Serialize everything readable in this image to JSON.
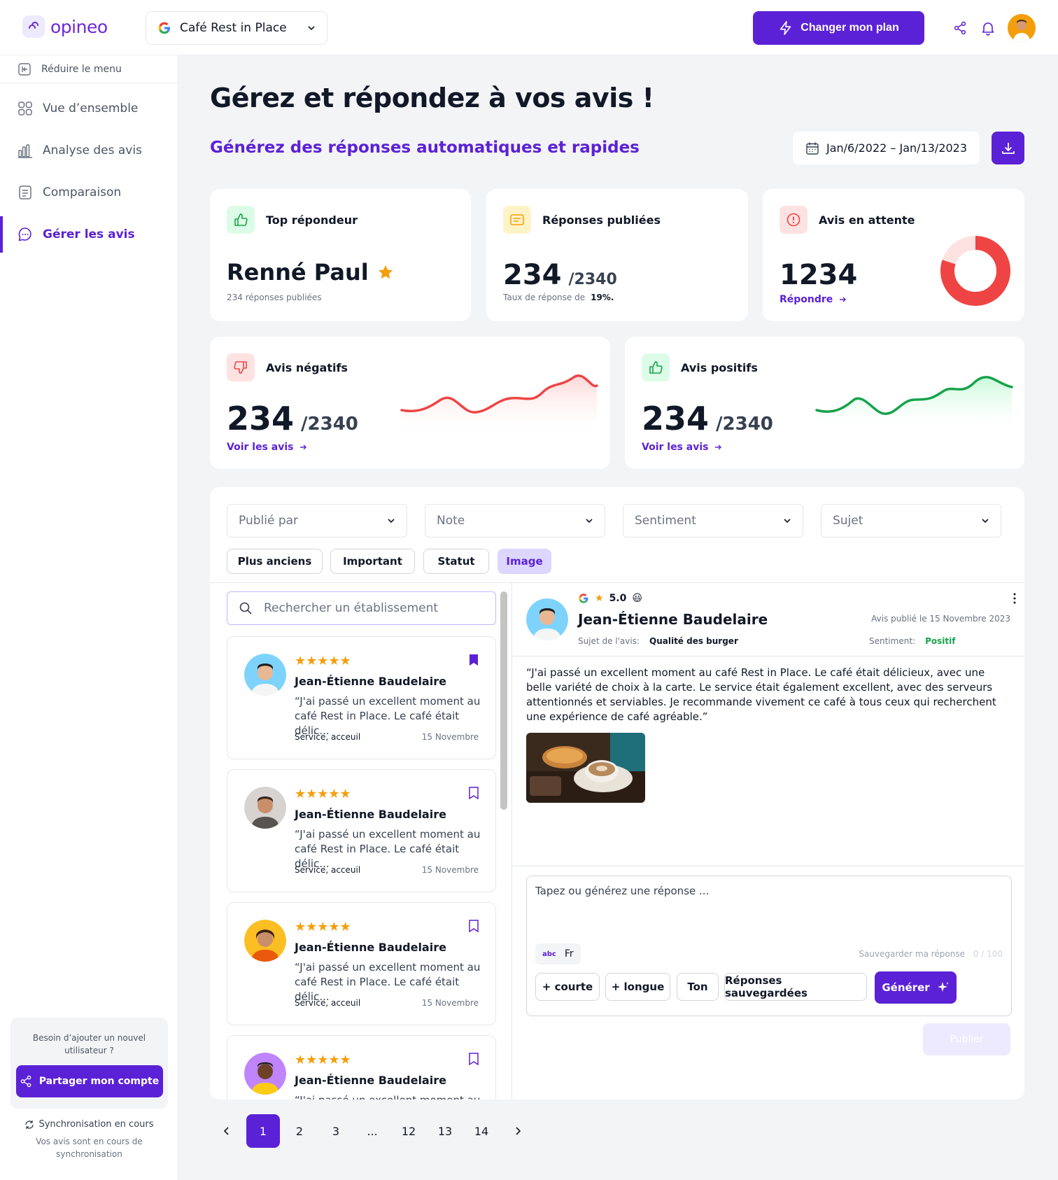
{
  "brand": {
    "name": "opineo",
    "accent": "#5b21d6"
  },
  "header": {
    "location": "Café Rest in Place",
    "plan_button": "Changer mon plan"
  },
  "sidebar": {
    "collapse": "Réduire le menu",
    "items": [
      {
        "label": "Vue d’ensemble",
        "icon": "grid-icon"
      },
      {
        "label": "Analyse des avis",
        "icon": "bar-chart-icon"
      },
      {
        "label": "Comparaison",
        "icon": "document-icon"
      },
      {
        "label": "Gérer les avis",
        "icon": "chat-icon",
        "active": true
      }
    ],
    "help": {
      "text": "Besoin d’ajouter un nouvel utilisateur ?",
      "button": "Partager mon compte"
    },
    "sync": {
      "title": "Synchronisation en cours",
      "subtitle": "Vos avis sont en cours de synchronisation"
    }
  },
  "page": {
    "title": "Gérez et répondez à vos avis !",
    "subtitle": "Générez des réponses automatiques et rapides",
    "date_range": "Jan/6/2022 – Jan/13/2023"
  },
  "stats": {
    "top": {
      "title": "Top répondeur",
      "name": "Renné Paul",
      "sub": "234 réponses publiées"
    },
    "published": {
      "title": "Réponses publiées",
      "value": "234",
      "total": "/2340",
      "rate_label": "Taux de réponse de",
      "rate": "19%."
    },
    "pending": {
      "title": "Avis en attente",
      "value": "1234",
      "link": "Répondre",
      "donut_fraction": 0.8
    },
    "negative": {
      "title": "Avis négatifs",
      "value": "234",
      "total": "/2340",
      "link": "Voir les avis",
      "color": "#ef4444"
    },
    "positive": {
      "title": "Avis positifs",
      "value": "234",
      "total": "/2340",
      "link": "Voir les avis",
      "color": "#16a34a"
    }
  },
  "filters": {
    "selects": [
      "Publié par",
      "Note",
      "Sentiment",
      "Sujet"
    ],
    "chips": [
      "Plus anciens",
      "Important",
      "Statut",
      "Image"
    ],
    "selected_chip": "Image"
  },
  "list": {
    "search_placeholder": "Rechercher un établissement",
    "reviews": [
      {
        "name": "Jean-Étienne Baudelaire",
        "text": "“J'ai passé un excellent moment au café Rest in Place. Le café était délic...",
        "tag": "Service, acceuil",
        "date": "15 Novembre",
        "rating": 5,
        "bookmarked": true
      },
      {
        "name": "Jean-Étienne Baudelaire",
        "text": "“J'ai passé un excellent moment au café Rest in Place. Le café était délic...",
        "tag": "Service, acceuil",
        "date": "15 Novembre",
        "rating": 5,
        "bookmarked": false
      },
      {
        "name": "Jean-Étienne Baudelaire",
        "text": "“J'ai passé un excellent moment au café Rest in Place. Le café était délic...",
        "tag": "Service, acceuil",
        "date": "15 Novembre",
        "rating": 5,
        "bookmarked": false
      },
      {
        "name": "Jean-Étienne Baudelaire",
        "text": "“J'ai passé un excellent moment au",
        "rating": 5,
        "bookmarked": false
      }
    ]
  },
  "detail": {
    "rating": "5.0",
    "emoji": "😃",
    "name": "Jean-Étienne Baudelaire",
    "published": "Avis publié le 15 Novembre 2023",
    "subject_label": "Sujet de l'avis:",
    "subject": "Qualité des burger",
    "sentiment_label": "Sentiment:",
    "sentiment": "Positif",
    "body": "“J'ai passé un excellent moment au café Rest in Place. Le café était délicieux, avec une belle variété de choix à la carte. Le service était également excellent, avec des serveurs attentionnés et serviables. Je recommande vivement ce café à tous ceux qui recherchent une expérience de café agréable.”",
    "reply_placeholder": "Tapez ou générez une réponse ...",
    "lang": "Fr",
    "save": "Sauvegarder ma réponse",
    "counter": "0 / 100",
    "buttons": [
      "+ courte",
      "+ longue",
      "Ton",
      "Réponses sauvegardées"
    ],
    "generate": "Générer",
    "publish": "Publier"
  },
  "pagination": {
    "pages": [
      "1",
      "2",
      "3",
      "...",
      "12",
      "13",
      "14"
    ],
    "current": "1"
  }
}
